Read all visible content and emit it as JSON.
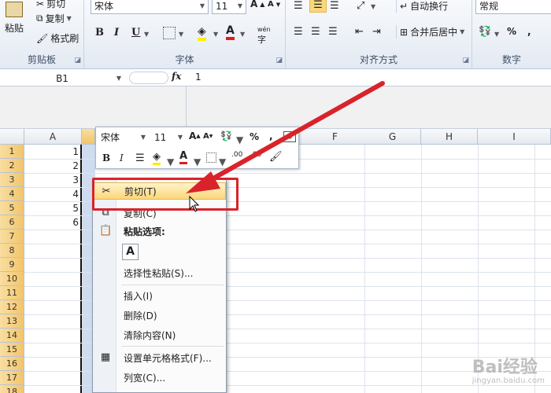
{
  "ribbon": {
    "clipboard": {
      "label": "剪贴板",
      "paste": "粘贴",
      "cut": "剪切",
      "copy": "复制",
      "format_painter": "格式刷"
    },
    "font": {
      "label": "字体",
      "font_name": "宋体",
      "font_size": "11",
      "bold": "B",
      "italic": "I",
      "underline": "U",
      "phonetic": "wén"
    },
    "alignment": {
      "label": "对齐方式",
      "wrap_text": "自动换行",
      "merge_center": "合并后居中"
    },
    "number": {
      "label": "数字",
      "format": "常规",
      "percent": "%"
    }
  },
  "formula_bar": {
    "name_box": "B1",
    "fx": "fx",
    "content": "1"
  },
  "grid": {
    "columns": [
      "A",
      "B",
      "C",
      "D",
      "E",
      "F",
      "G",
      "H",
      "I"
    ],
    "rows": [
      "1",
      "2",
      "3",
      "4",
      "5",
      "6",
      "7",
      "8",
      "9",
      "10",
      "11",
      "12",
      "13",
      "14",
      "15",
      "16",
      "17",
      "18"
    ],
    "column_a_values": [
      "1",
      "2",
      "3",
      "4",
      "5",
      "6"
    ],
    "selected_column": "B"
  },
  "mini_toolbar": {
    "font_name": "宋体",
    "font_size": "11",
    "bold": "B",
    "italic": "I",
    "percent": "%",
    "comma": ",",
    "inc_decimal": ".00",
    "dec_decimal": ".00"
  },
  "context_menu": {
    "items": [
      {
        "label": "剪切(T)",
        "icon": "scissors-icon",
        "highlighted": true
      },
      {
        "label": "复制(C)",
        "icon": "copy-icon"
      },
      {
        "label": "粘贴选项:",
        "icon": "paste-icon",
        "bold": true
      },
      {
        "label": "选择性粘贴(S)...",
        "icon": ""
      },
      {
        "label": "插入(I)",
        "icon": ""
      },
      {
        "label": "删除(D)",
        "icon": ""
      },
      {
        "label": "清除内容(N)",
        "icon": ""
      },
      {
        "label": "设置单元格格式(F)...",
        "icon": "format-cells-icon"
      },
      {
        "label": "列宽(C)...",
        "icon": ""
      }
    ],
    "paste_option_glyph": "A"
  },
  "watermark": {
    "text": "Bai经验",
    "sub": "jingyan.baidu.com"
  },
  "colors": {
    "annotation_red": "#d9232a",
    "highlight": "#fbd77c",
    "selection_header": "#f2c56a"
  }
}
